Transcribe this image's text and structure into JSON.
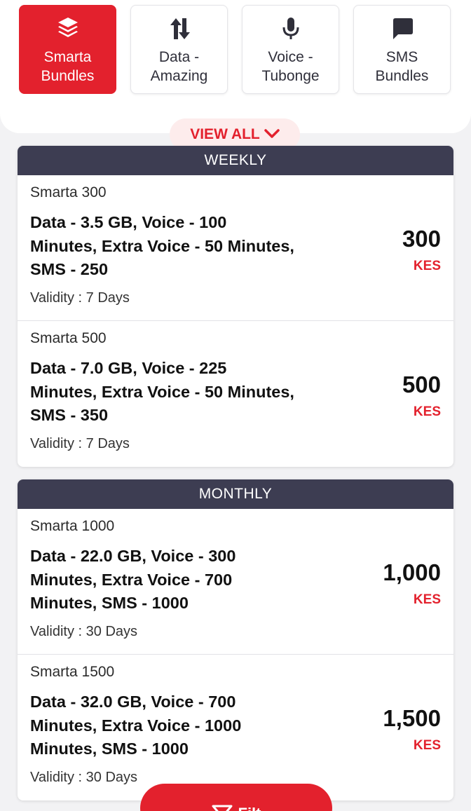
{
  "categories": [
    {
      "label": "Smarta\nBundles",
      "icon": "layers-icon",
      "active": true
    },
    {
      "label": "Data -\nAmazing",
      "icon": "data-transfer-icon",
      "active": false
    },
    {
      "label": "Voice -\nTubonge",
      "icon": "microphone-icon",
      "active": false
    },
    {
      "label": "SMS\nBundles",
      "icon": "message-icon",
      "active": false
    }
  ],
  "view_all": {
    "label": "VIEW ALL",
    "icon": "chevron-down-icon"
  },
  "sections": [
    {
      "title": "WEEKLY",
      "bundles": [
        {
          "name": "Smarta 300",
          "description": "Data - 3.5 GB, Voice - 100 Minutes, Extra Voice - 50 Minutes, SMS - 250",
          "validity": "Validity : 7 Days",
          "price": "300",
          "currency": "KES"
        },
        {
          "name": "Smarta 500",
          "description": "Data - 7.0 GB, Voice - 225 Minutes, Extra Voice - 50 Minutes, SMS - 350",
          "validity": "Validity : 7 Days",
          "price": "500",
          "currency": "KES"
        }
      ]
    },
    {
      "title": "MONTHLY",
      "bundles": [
        {
          "name": "Smarta 1000",
          "description": "Data - 22.0 GB, Voice - 300 Minutes, Extra Voice - 700 Minutes, SMS - 1000",
          "validity": "Validity : 30 Days",
          "price": "1,000",
          "currency": "KES"
        },
        {
          "name": "Smarta 1500",
          "description": "Data - 32.0 GB, Voice - 700 Minutes, Extra Voice - 1000 Minutes, SMS - 1000",
          "validity": "Validity : 30 Days",
          "price": "1,500",
          "currency": "KES"
        }
      ]
    }
  ],
  "filter_button": {
    "label": "Filt",
    "icon": "filter-icon"
  },
  "colors": {
    "accent": "#e3212d",
    "header": "#3d3d52",
    "background": "#f2f2f4"
  }
}
